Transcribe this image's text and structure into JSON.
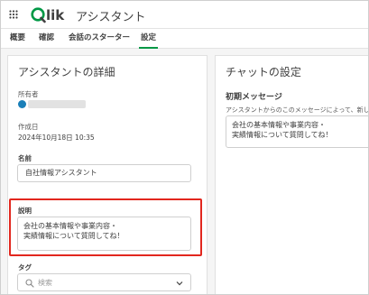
{
  "app": {
    "name": "アシスタント"
  },
  "tabs": [
    {
      "label": "概要"
    },
    {
      "label": "確認"
    },
    {
      "label": "会話のスターター"
    },
    {
      "label": "設定"
    }
  ],
  "details": {
    "title": "アシスタントの詳細",
    "owner_label": "所有者",
    "created_label": "作成日",
    "created_value": "2024年10月18日 10:35",
    "name_label": "名前",
    "name_value": "自社情報アシスタント",
    "description_label": "説明",
    "description_value": "会社の基本情報や事業内容・\n実績情報について質問してね！",
    "tags_label": "タグ",
    "tags_placeholder": "検索"
  },
  "chat": {
    "title": "チャットの設定",
    "initial_message_label": "初期メッセージ",
    "initial_message_help": "アシスタントからのこのメッセージによって、新しい",
    "initial_message_value": "会社の基本情報や事業内容・\n実績情報について質問してね！"
  },
  "colors": {
    "accent": "#009845",
    "highlight": "#e2271e",
    "brand": "#009845"
  }
}
